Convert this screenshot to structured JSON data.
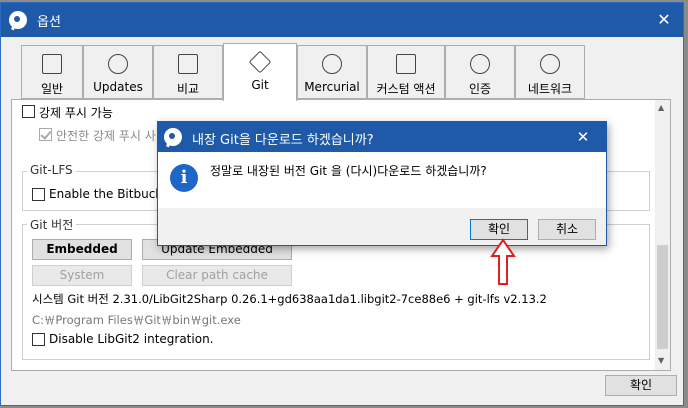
{
  "window": {
    "title": "옵션",
    "close_glyph": "✕"
  },
  "tabs": [
    {
      "label": "일반",
      "icon": "switch-icon"
    },
    {
      "label": "Updates",
      "icon": "download-icon"
    },
    {
      "label": "비교",
      "icon": "compare-icon"
    },
    {
      "label": "Git",
      "icon": "git-icon"
    },
    {
      "label": "Mercurial",
      "icon": "mercurial-icon"
    },
    {
      "label": "커스텀 액션",
      "icon": "flowchart-icon"
    },
    {
      "label": "인증",
      "icon": "user-icon"
    },
    {
      "label": "네트워크",
      "icon": "globe-icon"
    }
  ],
  "content": {
    "force_push": "강제 푸시 가능",
    "safe_force_push": "안전한 강제 푸시 사",
    "git_lfs_group": "Git-LFS",
    "enable_bitbucket": "Enable the Bitbucket",
    "git_version_group": "Git 버전",
    "embedded_btn": "Embedded",
    "update_embedded_btn": "Update Embedded",
    "system_btn": "System",
    "clear_cache_btn": "Clear path cache",
    "system_git_version": "시스템 Git 버전 2.31.0/LibGit2Sharp 0.26.1+gd638aa1da1.libgit2-7ce88e6 + git-lfs v2.13.2",
    "git_path": "C:￦Program Files￦Git￦bin￦git.exe",
    "disable_libgit2": "Disable LibGit2 integration."
  },
  "footer": {
    "ok_label": "확인"
  },
  "dialog": {
    "title": "내장 Git을 다운로드 하겠습니까?",
    "message": "정말로 내장된 버전 Git 을 (다시)다운로드 하겠습니까?",
    "confirm_label": "확인",
    "cancel_label": "취소",
    "close_glyph": "✕",
    "icon": "info-icon"
  },
  "colors": {
    "titlebar": "#1e5aa8",
    "annotation_arrow": "#e02020"
  }
}
